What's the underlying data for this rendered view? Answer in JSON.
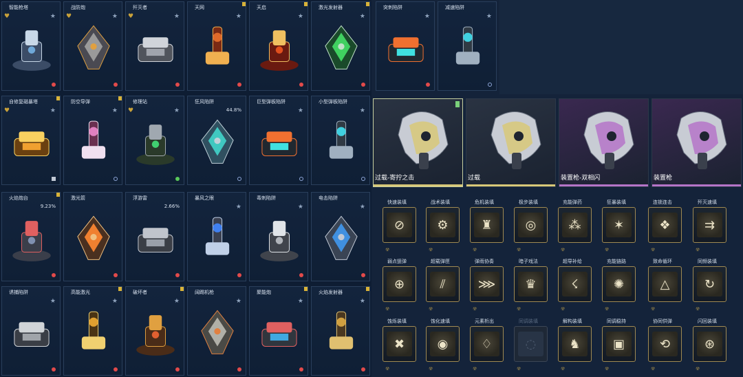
{
  "turrets": [
    {
      "name": "智能枪塔",
      "left_badge": "heart",
      "top_icon": "star",
      "bottom_icon": "red",
      "gold_corner": false
    },
    {
      "name": "战防炮",
      "left_badge": "heart",
      "top_icon": "star",
      "bottom_icon": "red",
      "gold_corner": false
    },
    {
      "name": "歼灭者",
      "left_badge": "heart",
      "top_icon": "star",
      "bottom_icon": "red",
      "gold_corner": false
    },
    {
      "name": "天网",
      "left_badge": "",
      "top_icon": "star",
      "bottom_icon": "red",
      "gold_corner": true
    },
    {
      "name": "天启",
      "left_badge": "",
      "top_icon": "star",
      "bottom_icon": "red",
      "gold_corner": true
    },
    {
      "name": "激光发射器",
      "left_badge": "",
      "top_icon": "star",
      "bottom_icon": "red",
      "gold_corner": true
    },
    {
      "name": "自修复磁暴塔",
      "left_badge": "heart",
      "top_icon": "star",
      "bottom_icon": "white",
      "gold_corner": true
    },
    {
      "name": "防空导弹",
      "left_badge": "",
      "top_icon": "star",
      "bottom_icon": "blue",
      "gold_corner": true
    },
    {
      "name": "修理站",
      "left_badge": "heart",
      "top_icon": "star",
      "bottom_icon": "green",
      "gold_corner": false
    },
    {
      "name": "狂风陷阱",
      "left_badge": "",
      "top_icon": "pct",
      "pct": "44.8%",
      "bottom_icon": "blue",
      "gold_corner": false
    },
    {
      "name": "巨型弹板陷阱",
      "left_badge": "",
      "top_icon": "star",
      "bottom_icon": "blue",
      "gold_corner": false
    },
    {
      "name": "小型弹板陷阱",
      "left_badge": "",
      "top_icon": "star",
      "bottom_icon": "blue",
      "gold_corner": false
    },
    {
      "name": "火焰炮台",
      "left_badge": "",
      "top_icon": "pct",
      "pct": "9.23%",
      "bottom_icon": "red",
      "gold_corner": true
    },
    {
      "name": "激光箭",
      "left_badge": "",
      "top_icon": "",
      "bottom_icon": "red",
      "gold_corner": false
    },
    {
      "name": "浮游雷",
      "left_badge": "",
      "top_icon": "pct",
      "pct": "2.66%",
      "bottom_icon": "red",
      "gold_corner": false
    },
    {
      "name": "暴风之眼",
      "left_badge": "",
      "top_icon": "star",
      "bottom_icon": "red",
      "gold_corner": false
    },
    {
      "name": "毒刺陷阱",
      "left_badge": "",
      "top_icon": "star",
      "bottom_icon": "red",
      "gold_corner": false
    },
    {
      "name": "电击陷阱",
      "left_badge": "",
      "top_icon": "star",
      "bottom_icon": "red",
      "gold_corner": false
    },
    {
      "name": "诱捕陷阱",
      "left_badge": "",
      "top_icon": "star",
      "bottom_icon": "red",
      "gold_corner": false
    },
    {
      "name": "高能激光",
      "left_badge": "",
      "top_icon": "star",
      "bottom_icon": "red",
      "gold_corner": true
    },
    {
      "name": "破坏者",
      "left_badge": "",
      "top_icon": "star",
      "bottom_icon": "red",
      "gold_corner": true
    },
    {
      "name": "阔踢机枪",
      "left_badge": "",
      "top_icon": "star",
      "bottom_icon": "red",
      "gold_corner": false
    },
    {
      "name": "聚能炮",
      "left_badge": "",
      "top_icon": "star",
      "bottom_icon": "red",
      "gold_corner": true
    },
    {
      "name": "火焰发射器",
      "left_badge": "",
      "top_icon": "star",
      "bottom_icon": "red",
      "gold_corner": true
    }
  ],
  "traps": [
    {
      "name": "突刺陷阱",
      "bottom_icon": "red"
    },
    {
      "name": "减速陷阱",
      "bottom_icon": "blue"
    }
  ],
  "weapons": [
    {
      "name": "过载-寄拧之击",
      "accent": "#d8c878",
      "bg": "#2a3342",
      "selected": true
    },
    {
      "name": "过载",
      "accent": "#d8c878",
      "bg": "#2a3342",
      "selected": false
    },
    {
      "name": "装置枪-双相闪",
      "accent": "#b574c8",
      "bg": "#3a2850",
      "selected": false
    },
    {
      "name": "装置枪",
      "accent": "#b574c8",
      "bg": "#3a2850",
      "selected": false
    }
  ],
  "modules": [
    {
      "name": "快速装填",
      "glyph": "⊘",
      "locked": false
    },
    {
      "name": "战术装填",
      "glyph": "⚙",
      "locked": false
    },
    {
      "name": "危机装填",
      "glyph": "♜",
      "locked": false
    },
    {
      "name": "极步装填",
      "glyph": "◎",
      "locked": false
    },
    {
      "name": "充能弹药",
      "glyph": "⁂",
      "locked": false
    },
    {
      "name": "狂暴装填",
      "glyph": "✶",
      "locked": false
    },
    {
      "name": "连锁连击",
      "glyph": "❖",
      "locked": false
    },
    {
      "name": "歼灭速填",
      "glyph": "⇉",
      "locked": false
    },
    {
      "name": "弱点狙弹",
      "glyph": "⊕",
      "locked": false
    },
    {
      "name": "超载弹匣",
      "glyph": "⫽",
      "locked": false
    },
    {
      "name": "弹雨协奏",
      "glyph": "⋙",
      "locked": false
    },
    {
      "name": "暗子戏法",
      "glyph": "♛",
      "locked": false
    },
    {
      "name": "超导补给",
      "glyph": "☇",
      "locked": false
    },
    {
      "name": "充能链路",
      "glyph": "✺",
      "locked": false
    },
    {
      "name": "致命循环",
      "glyph": "△",
      "locked": false
    },
    {
      "name": "同频装填",
      "glyph": "↻",
      "locked": false
    },
    {
      "name": "蚀烁装填",
      "glyph": "✖",
      "locked": false
    },
    {
      "name": "蚀化速填",
      "glyph": "◉",
      "locked": false
    },
    {
      "name": "元素析出",
      "glyph": "♢",
      "locked": false
    },
    {
      "name": "同调装填",
      "glyph": "◌",
      "locked": true
    },
    {
      "name": "解构装填",
      "glyph": "♞",
      "locked": false
    },
    {
      "name": "同调稳持",
      "glyph": "▣",
      "locked": false
    },
    {
      "name": "协同供弹",
      "glyph": "⟲",
      "locked": false
    },
    {
      "name": "闪回装填",
      "glyph": "⊛",
      "locked": false
    }
  ],
  "colors": {
    "left_bg": "#0e1d33",
    "card_border": "#2a3f5c",
    "gold": "#d8b238",
    "weapon_gold": "#d8c878",
    "weapon_purple": "#b574c8",
    "module_border": "#a08a52"
  }
}
